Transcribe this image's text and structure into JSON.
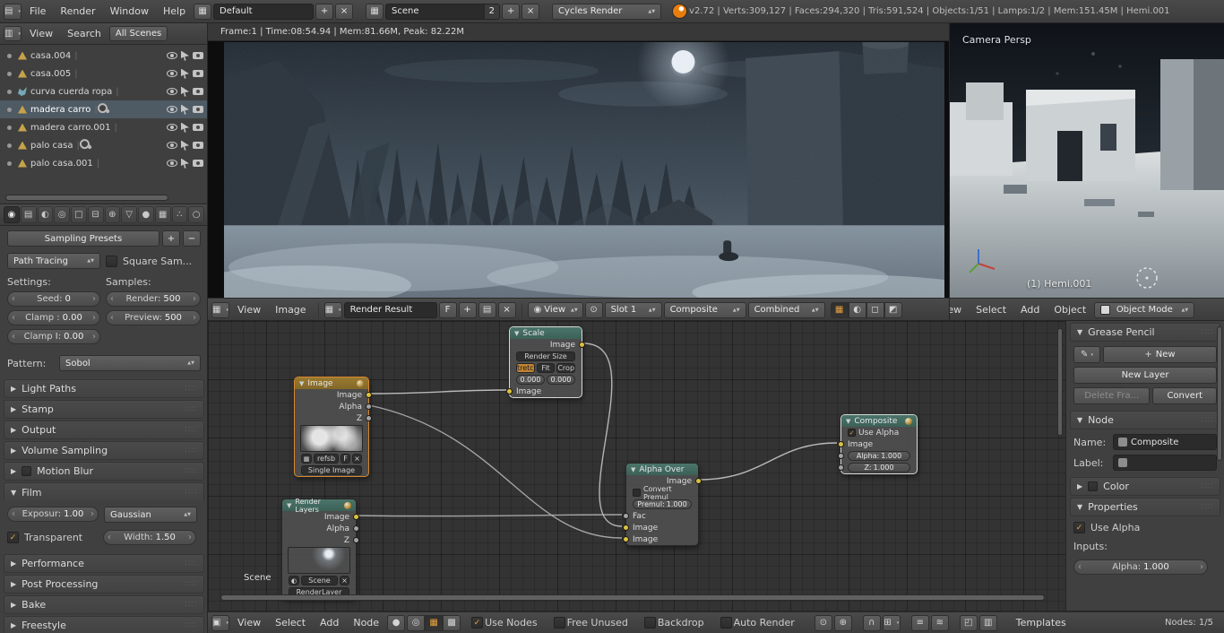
{
  "topbar": {
    "menus": [
      "File",
      "Render",
      "Window",
      "Help"
    ],
    "layout": {
      "value": "Default",
      "add": "+",
      "close": "×"
    },
    "scene": {
      "value": "Scene",
      "users": "2",
      "add": "+",
      "close": "×"
    },
    "engine": "Cycles Render",
    "stats": "v2.72 | Verts:309,127 | Faces:294,320 | Tris:591,524 | Objects:1/51 | Lamps:1/2 | Mem:151.45M | Hemi.001"
  },
  "outliner": {
    "view_menu": "View",
    "search_menu": "Search",
    "display_mode": "All Scenes",
    "items": [
      {
        "label": "casa.004"
      },
      {
        "label": "casa.005"
      },
      {
        "label": "curva cuerda ropa"
      },
      {
        "label": "madera carro"
      },
      {
        "label": "madera carro.001"
      },
      {
        "label": "palo casa"
      },
      {
        "label": "palo casa.001"
      }
    ]
  },
  "properties": {
    "presets": "Sampling Presets",
    "add": "+",
    "remove": "−",
    "integrator": "Path Tracing",
    "square_samples": "Square Sam...",
    "settings_label": "Settings:",
    "samples_label": "Samples:",
    "seed_label": "Seed:",
    "seed_value": "0",
    "render_label": "Render:",
    "render_value": "500",
    "clamp_label": "Clamp :",
    "clamp_value": "0.00",
    "preview_label": "Preview:",
    "preview_value": "500",
    "clamp_i_label": "Clamp I:",
    "clamp_i_value": "0.00",
    "pattern_label": "Pattern:",
    "pattern_value": "Sobol",
    "collapsed_top": [
      "Light Paths",
      "Stamp",
      "Output",
      "Volume Sampling",
      "Motion Blur"
    ],
    "film": {
      "title": "Film",
      "exposure_label": "Exposur:",
      "exposure_value": "1.00",
      "filter": "Gaussian",
      "transparent": "Transparent",
      "width_label": "Width:",
      "width_value": "1.50"
    },
    "collapsed_bottom": [
      "Performance",
      "Post Processing",
      "Bake",
      "Freestyle"
    ]
  },
  "image_editor": {
    "info": "Frame:1 | Time:08:54.94 | Mem:81.66M, Peak: 82.22M",
    "menus": [
      "View",
      "Image"
    ],
    "datablock": "Render Result",
    "fake_user": "F",
    "add": "+",
    "close": "×",
    "view_dropdown": "View",
    "slot": "Slot 1",
    "layer": "Composite",
    "pass": "Combined"
  },
  "viewport": {
    "overlay": "Camera Persp",
    "lamp_label": "(1) Hemi.001",
    "menus": [
      "View",
      "Select",
      "Add",
      "Object"
    ],
    "mode": "Object Mode"
  },
  "node_editor": {
    "menus": [
      "View",
      "Select",
      "Add",
      "Node"
    ],
    "use_nodes": "Use Nodes",
    "free_unused": "Free Unused",
    "backdrop": "Backdrop",
    "auto_render": "Auto Render",
    "templates": "Templates",
    "status": "Nodes: 1/5",
    "scene_tag": "Scene",
    "nodes": {
      "scale": {
        "title": "Scale",
        "out": "Image",
        "space": "Render Size",
        "opt1": "Stretch",
        "opt2": "Fit",
        "opt3": "Crop",
        "x": "0.000",
        "y": "0.000",
        "in": "Image"
      },
      "image": {
        "title": "Image",
        "out1": "Image",
        "out2": "Alpha",
        "out3": "Z",
        "datablock": "refsb",
        "fake_user": "F",
        "close": "×",
        "source": "Single Image"
      },
      "render_layers": {
        "title": "Render Layers",
        "out1": "Image",
        "out2": "Alpha",
        "out3": "Z",
        "scene": "Scene",
        "close": "×",
        "layer": "RenderLayer"
      },
      "alpha_over": {
        "title": "Alpha Over",
        "out": "Image",
        "convert": "Convert Premul",
        "premul_label": "Premul:",
        "premul_value": "1.000",
        "in1": "Fac",
        "in2": "Image",
        "in3": "Image"
      },
      "composite": {
        "title": "Composite",
        "use_alpha": "Use Alpha",
        "in": "Image",
        "alpha_label": "Alpha:",
        "alpha_value": "1.000",
        "z_label": "Z:",
        "z_value": "1.000"
      }
    }
  },
  "sidebar": {
    "grease_pencil": {
      "title": "Grease Pencil",
      "new": "New",
      "new_layer": "New Layer",
      "delete_frame": "Delete Fra...",
      "convert": "Convert"
    },
    "node": {
      "title": "Node",
      "name_label": "Name:",
      "name_value": "Composite",
      "label_label": "Label:"
    },
    "color": {
      "title": "Color"
    },
    "props": {
      "title": "Properties",
      "use_alpha": "Use Alpha",
      "inputs_label": "Inputs:",
      "alpha_label": "Alpha:",
      "alpha_value": "1.000"
    }
  }
}
